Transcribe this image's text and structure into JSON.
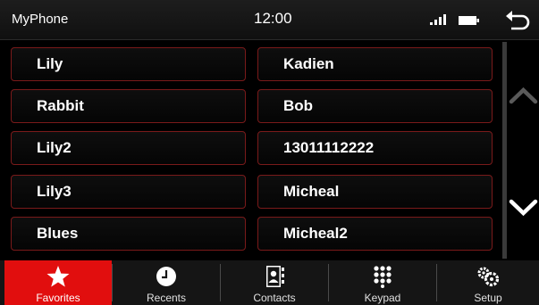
{
  "status": {
    "title": "MyPhone",
    "time": "12:00"
  },
  "contacts": {
    "left": [
      "Lily",
      "Rabbit",
      "Lily2",
      "Lily3",
      "Blues"
    ],
    "right": [
      "Kadien",
      "Bob",
      "13011112222",
      "Micheal",
      "Micheal2"
    ]
  },
  "nav": {
    "active": "Favorites",
    "tabs": [
      {
        "label": "Favorites",
        "icon": "star-icon"
      },
      {
        "label": "Recents",
        "icon": "clock-icon"
      },
      {
        "label": "Contacts",
        "icon": "contact-book-icon"
      },
      {
        "label": "Keypad",
        "icon": "keypad-icon"
      },
      {
        "label": "Setup",
        "icon": "gears-icon"
      }
    ]
  },
  "colors": {
    "accent": "#e10e0e",
    "button_border": "#7a1a1a",
    "background": "#000000"
  }
}
